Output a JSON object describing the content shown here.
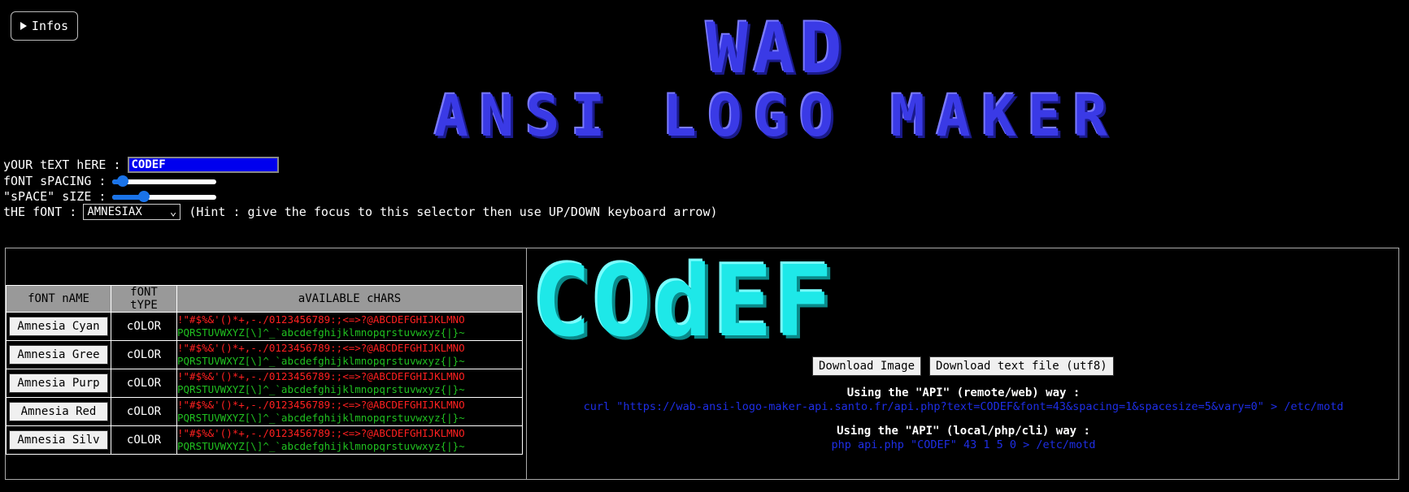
{
  "header": {
    "infos_label": "Infos",
    "logo_line1": "WAD",
    "logo_line2": "ANSI LOGO MAKER"
  },
  "controls": {
    "text_label": "yOUR tEXT hERE :",
    "text_value": "CODEF",
    "spacing_label": "fONT sPACING :",
    "spacing_value": 0.1,
    "space_label": "\"sPACE\" sIZE :",
    "space_value": 0.3,
    "font_label": "tHE fONT :",
    "font_value": "AMNESIAX",
    "hint": "(Hint : give the focus to this selector then use UP/DOWN keyboard arrow)"
  },
  "table": {
    "headers": [
      "fONT nAME",
      "fONT tYPE",
      "aVAILABLE cHARS"
    ],
    "chars_line1": "!\"#$%&'()*+,-./0123456789:;<=>?@ABCDEFGHIJKLMNO",
    "chars_line2": "PQRSTUVWXYZ[\\]^_`abcdefghijklmnopqrstuvwxyz{|}~",
    "rows": [
      {
        "name": "Amnesia Cyan",
        "type": "cOLOR"
      },
      {
        "name": "Amnesia Gree",
        "type": "cOLOR"
      },
      {
        "name": "Amnesia Purp",
        "type": "cOLOR"
      },
      {
        "name": "Amnesia Red",
        "type": "cOLOR"
      },
      {
        "name": "Amnesia Silv",
        "type": "cOLOR"
      }
    ]
  },
  "preview": {
    "text": "COdEF",
    "download_image": "Download Image",
    "download_text": "Download text file (utf8)",
    "api_remote_title": "Using the \"API\" (remote/web) way :",
    "api_remote_cmd": "curl \"https://wab-ansi-logo-maker-api.santo.fr/api.php?text=CODEF&font=43&spacing=1&spacesize=5&vary=0\" > /etc/motd",
    "api_local_title": "Using the \"API\" (local/php/cli) way :",
    "api_local_cmd": "php api.php \"CODEF\" 43 1 5 0 > /etc/motd"
  },
  "colors": {
    "logo": "#3a3ae6",
    "preview": "#1ee8e8",
    "chars_red": "#ff2020",
    "chars_green": "#20c020",
    "api_code": "#1e2ee6",
    "slider": "#1a73e8"
  }
}
